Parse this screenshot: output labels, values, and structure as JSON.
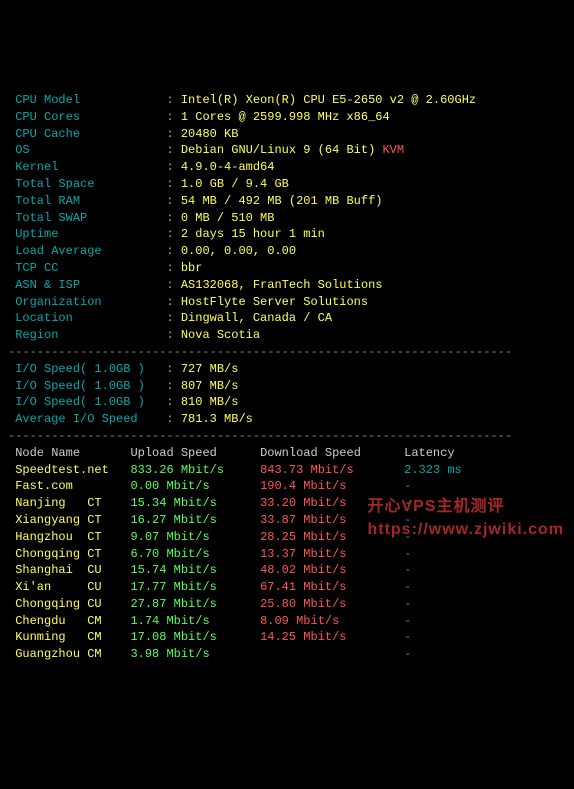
{
  "sysinfo": {
    "cpu_model": {
      "label": "CPU Model",
      "value": "Intel(R) Xeon(R) CPU E5-2650 v2 @ 2.60GHz"
    },
    "cpu_cores": {
      "label": "CPU Cores",
      "value": "1 Cores @ 2599.998 MHz x86_64"
    },
    "cpu_cache": {
      "label": "CPU Cache",
      "value": "20480 KB"
    },
    "os": {
      "label": "OS",
      "value_pre": "Debian GNU/Linux 9 (64 Bit) ",
      "value_tag": "KVM"
    },
    "kernel": {
      "label": "Kernel",
      "value": "4.9.0-4-amd64"
    },
    "total_space": {
      "label": "Total Space",
      "value": "1.0 GB / 9.4 GB"
    },
    "total_ram": {
      "label": "Total RAM",
      "value": "54 MB / 492 MB (201 MB Buff)"
    },
    "total_swap": {
      "label": "Total SWAP",
      "value": "0 MB / 510 MB"
    },
    "uptime": {
      "label": "Uptime",
      "value": "2 days 15 hour 1 min"
    },
    "load_avg": {
      "label": "Load Average",
      "value": "0.00, 0.00, 0.00"
    },
    "tcp_cc": {
      "label": "TCP CC",
      "value": "bbr"
    },
    "asn_isp": {
      "label": "ASN & ISP",
      "value": "AS132068, FranTech Solutions"
    },
    "organization": {
      "label": "Organization",
      "value": "HostFlyte Server Solutions"
    },
    "location": {
      "label": "Location",
      "value": "Dingwall, Canada / CA"
    },
    "region": {
      "label": "Region",
      "value": "Nova Scotia"
    }
  },
  "divider": "----------------------------------------------------------------------",
  "iotest": {
    "run1": {
      "label": "I/O Speed( 1.0GB )",
      "value": "727 MB/s"
    },
    "run2": {
      "label": "I/O Speed( 1.0GB )",
      "value": "807 MB/s"
    },
    "run3": {
      "label": "I/O Speed( 1.0GB )",
      "value": "810 MB/s"
    },
    "avg": {
      "label": "Average I/O Speed",
      "value": "781.3 MB/s"
    }
  },
  "speedtest": {
    "header": {
      "node": "Node Name",
      "upload": "Upload Speed",
      "download": "Download Speed",
      "latency": "Latency"
    },
    "rows": {
      "r0": {
        "node": "Speedtest.net",
        "upload": "833.26 Mbit/s",
        "download": "843.73 Mbit/s",
        "latency": "2.323 ms"
      },
      "r1": {
        "node": "Fast.com     ",
        "upload": "0.00 Mbit/s  ",
        "download": "190.4 Mbit/s ",
        "latency": "-"
      },
      "r2": {
        "node": "Nanjing   CT ",
        "upload": "15.34 Mbit/s ",
        "download": "33.20 Mbit/s ",
        "latency": "-"
      },
      "r3": {
        "node": "Xiangyang CT ",
        "upload": "16.27 Mbit/s ",
        "download": "33.87 Mbit/s ",
        "latency": "-"
      },
      "r4": {
        "node": "Hangzhou  CT ",
        "upload": "9.07 Mbit/s  ",
        "download": "28.25 Mbit/s ",
        "latency": "-"
      },
      "r5": {
        "node": "Chongqing CT ",
        "upload": "6.70 Mbit/s  ",
        "download": "13.37 Mbit/s ",
        "latency": "-"
      },
      "r6": {
        "node": "Shanghai  CU ",
        "upload": "15.74 Mbit/s ",
        "download": "48.02 Mbit/s ",
        "latency": "-"
      },
      "r7": {
        "node": "Xi'an     CU ",
        "upload": "17.77 Mbit/s ",
        "download": "67.41 Mbit/s ",
        "latency": "-"
      },
      "r8": {
        "node": "Chongqing CU ",
        "upload": "27.87 Mbit/s ",
        "download": "25.80 Mbit/s ",
        "latency": "-"
      },
      "r9": {
        "node": "Chengdu   CM ",
        "upload": "1.74 Mbit/s  ",
        "download": "8.09 Mbit/s  ",
        "latency": "-"
      },
      "r10": {
        "node": "Kunming   CM ",
        "upload": "17.08 Mbit/s ",
        "download": "14.25 Mbit/s ",
        "latency": "-"
      },
      "r11": {
        "node": "Guangzhou CM ",
        "upload": "3.98 Mbit/s  ",
        "download": "             ",
        "latency": "-"
      }
    }
  },
  "watermark": "开心VPS主机测评\nhttps://www.zjwiki.com"
}
